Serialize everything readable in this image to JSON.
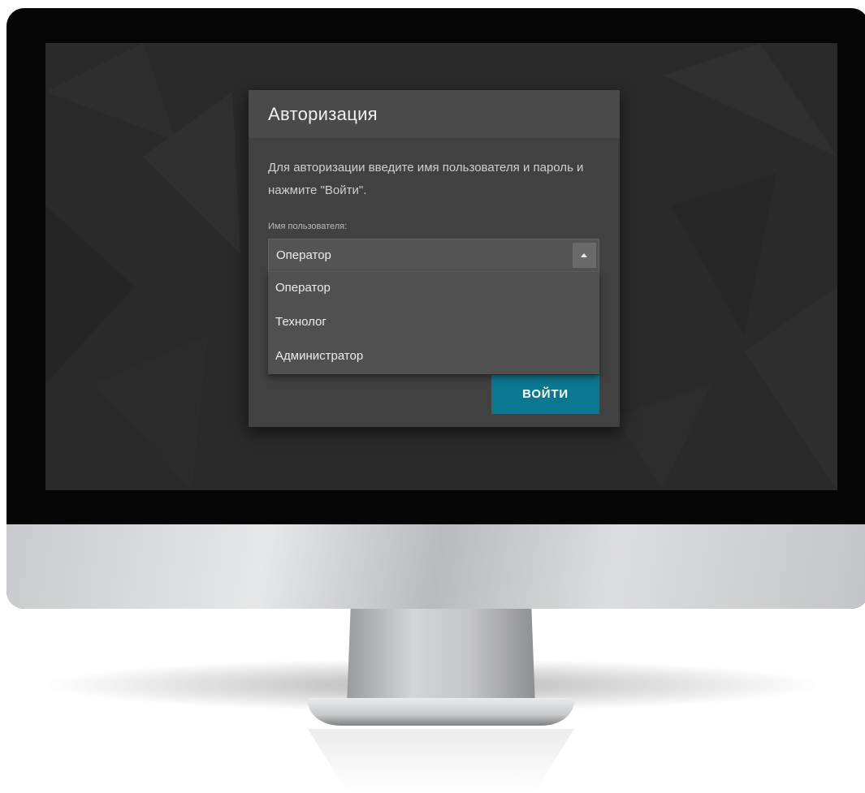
{
  "dialog": {
    "title": "Авторизация",
    "description": "Для авторизации введите имя пользователя и пароль и нажмите \"Войти\".",
    "username_label": "Имя пользователя:",
    "username_selected": "Оператор",
    "username_options": [
      "Оператор",
      "Технолог",
      "Администратор"
    ],
    "login_button": "ВОЙТИ"
  },
  "colors": {
    "screen_background": "#2a2a2a",
    "dialog_background": "#414141",
    "accent_button": "#0b7891"
  },
  "icons": {
    "select_toggle": "caret-up-icon"
  }
}
